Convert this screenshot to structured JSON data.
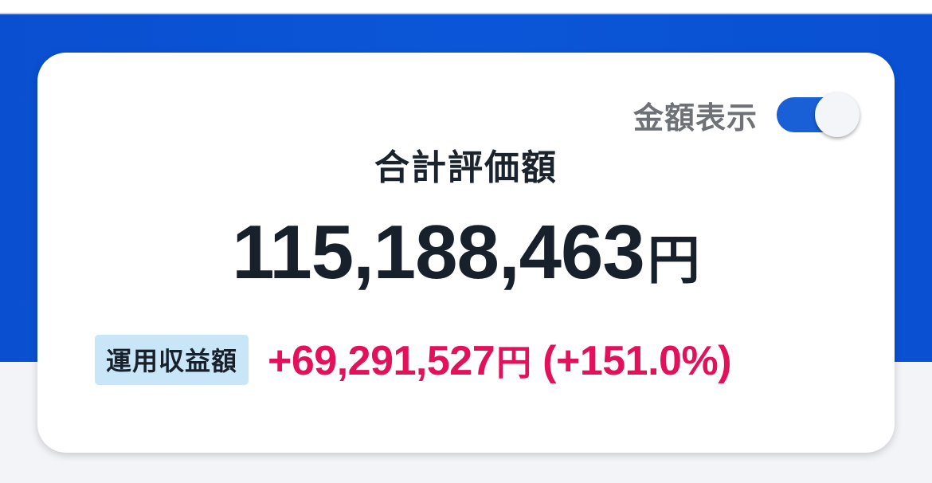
{
  "toggle": {
    "label": "金額表示",
    "on": true,
    "accent_color": "#1960d6"
  },
  "summary": {
    "title": "合計評価額",
    "total_value": "115,188,463",
    "total_unit": "円"
  },
  "profit": {
    "badge_label": "運用収益額",
    "amount": "+69,291,527",
    "unit": "円",
    "percent": "(+151.0%)",
    "color": "#e2115a"
  },
  "theme": {
    "brand_blue": "#0b56d8",
    "badge_bg": "#c8e6f8"
  }
}
